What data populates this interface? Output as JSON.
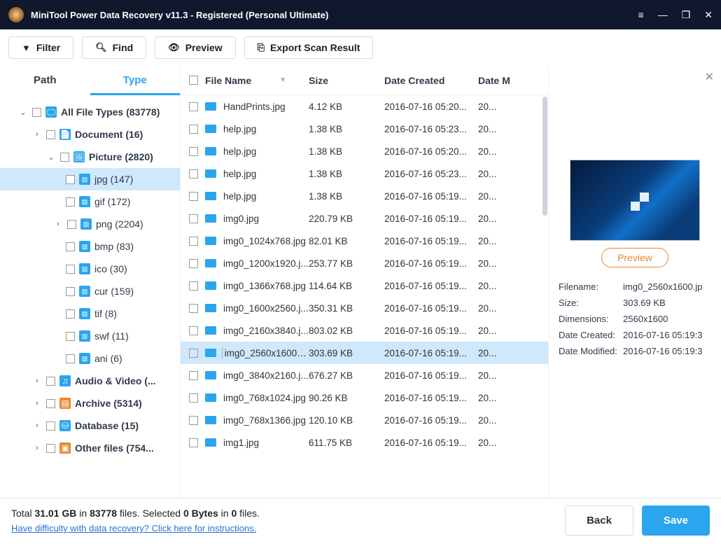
{
  "window": {
    "title": "MiniTool Power Data Recovery v11.3 - Registered (Personal Ultimate)"
  },
  "toolbar": {
    "filter": "Filter",
    "find": "Find",
    "preview": "Preview",
    "export": "Export Scan Result"
  },
  "tabs": {
    "path": "Path",
    "type": "Type"
  },
  "tree": {
    "root": "All File Types (83778)",
    "doc": "Document (16)",
    "pic": "Picture (2820)",
    "jpg": "jpg (147)",
    "gif": "gif (172)",
    "png": "png (2204)",
    "bmp": "bmp (83)",
    "ico": "ico (30)",
    "cur": "cur (159)",
    "tif": "tif (8)",
    "swf": "swf (11)",
    "ani": "ani (6)",
    "audio": "Audio & Video (...",
    "archive": "Archive (5314)",
    "database": "Database (15)",
    "other": "Other files (754..."
  },
  "grid": {
    "headers": {
      "name": "File Name",
      "size": "Size",
      "dc": "Date Created",
      "dm": "Date M"
    },
    "rows": [
      {
        "name": "HandPrints.jpg",
        "size": "4.12 KB",
        "dc": "2016-07-16 05:20...",
        "dm": "20..."
      },
      {
        "name": "help.jpg",
        "size": "1.38 KB",
        "dc": "2016-07-16 05:23...",
        "dm": "20..."
      },
      {
        "name": "help.jpg",
        "size": "1.38 KB",
        "dc": "2016-07-16 05:20...",
        "dm": "20..."
      },
      {
        "name": "help.jpg",
        "size": "1.38 KB",
        "dc": "2016-07-16 05:23...",
        "dm": "20..."
      },
      {
        "name": "help.jpg",
        "size": "1.38 KB",
        "dc": "2016-07-16 05:19...",
        "dm": "20..."
      },
      {
        "name": "img0.jpg",
        "size": "220.79 KB",
        "dc": "2016-07-16 05:19...",
        "dm": "20..."
      },
      {
        "name": "img0_1024x768.jpg",
        "size": "82.01 KB",
        "dc": "2016-07-16 05:19...",
        "dm": "20..."
      },
      {
        "name": "img0_1200x1920.j...",
        "size": "253.77 KB",
        "dc": "2016-07-16 05:19...",
        "dm": "20..."
      },
      {
        "name": "img0_1366x768.jpg",
        "size": "114.64 KB",
        "dc": "2016-07-16 05:19...",
        "dm": "20..."
      },
      {
        "name": "img0_1600x2560.j...",
        "size": "350.31 KB",
        "dc": "2016-07-16 05:19...",
        "dm": "20..."
      },
      {
        "name": "img0_2160x3840.j...",
        "size": "803.02 KB",
        "dc": "2016-07-16 05:19...",
        "dm": "20..."
      },
      {
        "name": "img0_2560x1600.j...",
        "size": "303.69 KB",
        "dc": "2016-07-16 05:19...",
        "dm": "20...",
        "selected": true
      },
      {
        "name": "img0_3840x2160.j...",
        "size": "676.27 KB",
        "dc": "2016-07-16 05:19...",
        "dm": "20..."
      },
      {
        "name": "img0_768x1024.jpg",
        "size": "90.26 KB",
        "dc": "2016-07-16 05:19...",
        "dm": "20..."
      },
      {
        "name": "img0_768x1366.jpg",
        "size": "120.10 KB",
        "dc": "2016-07-16 05:19...",
        "dm": "20..."
      },
      {
        "name": "img1.jpg",
        "size": "611.75 KB",
        "dc": "2016-07-16 05:19...",
        "dm": "20..."
      }
    ]
  },
  "preview": {
    "button": "Preview",
    "labels": {
      "filename": "Filename:",
      "size": "Size:",
      "dim": "Dimensions:",
      "dc": "Date Created:",
      "dm": "Date Modified:"
    },
    "values": {
      "filename": "img0_2560x1600.jp",
      "size": "303.69 KB",
      "dim": "2560x1600",
      "dc": "2016-07-16 05:19:3",
      "dm": "2016-07-16 05:19:3"
    }
  },
  "footer": {
    "total_pre": "Total ",
    "total_gb": "31.01 GB",
    "total_mid1": " in ",
    "total_files": "83778",
    "total_mid2": " files.  Selected ",
    "sel_bytes": "0 Bytes",
    "sel_mid": " in ",
    "sel_files": "0",
    "sel_post": " files.",
    "link": "Have difficulty with data recovery? Click here for instructions.",
    "back": "Back",
    "save": "Save"
  }
}
